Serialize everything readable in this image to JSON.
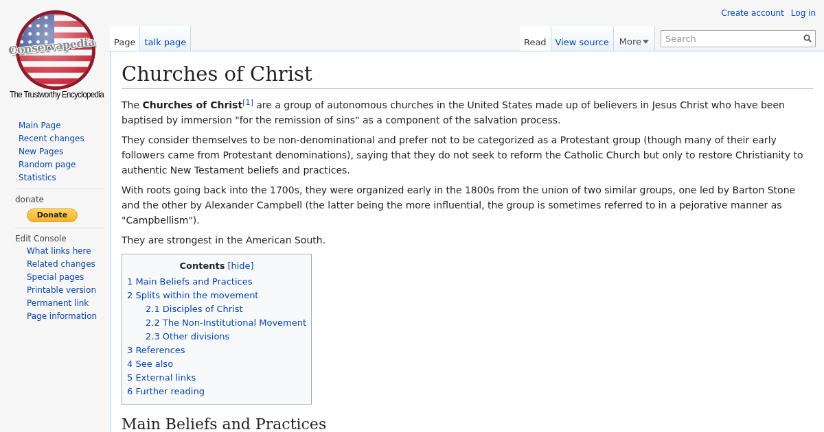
{
  "logo": {
    "name": "Conservapedia",
    "tagline": "The Trustworthy Encyclopedia"
  },
  "personal_tools": [
    "Create account",
    "Log in"
  ],
  "left_tabs": [
    {
      "label": "Page",
      "selected": true
    },
    {
      "label": "talk page",
      "selected": false
    }
  ],
  "right_tabs": [
    {
      "label": "Read",
      "selected": true
    },
    {
      "label": "View source",
      "selected": false
    }
  ],
  "more_menu": "More",
  "search": {
    "placeholder": "Search"
  },
  "sidebar": [
    {
      "kind": "links",
      "items": [
        "Main Page",
        "Recent changes",
        "New Pages",
        "Random page",
        "Statistics"
      ]
    },
    {
      "kind": "donate",
      "heading": "donate",
      "button": "Donate"
    },
    {
      "kind": "links",
      "heading": "Edit Console",
      "items": [
        "What links here",
        "Related changes",
        "Special pages",
        "Printable version",
        "Permanent link",
        "Page information"
      ]
    }
  ],
  "article": {
    "title": "Churches of Christ",
    "paragraphs": [
      "The **Churches of Christ**$^{[1]}$ are a group of autonomous churches in the United States made up of believers in Jesus Christ who have been baptised by immersion \"for the remission of sins\" as a component of the salvation process.",
      "They consider themselves to be non-denominational and prefer not to be categorized as a Protestant group (though many of their early followers came from Protestant denominations), saying that they do not seek to reform the Catholic Church but only to restore Christianity to authentic New Testament beliefs and practices.",
      "With roots going back into the 1700s, they were organized early in the 1800s from the union of two similar groups, one led by Barton Stone and the other by Alexander Campbell (the latter being the more influential, the group is sometimes referred to in a pejorative manner as \"Campbellism\").",
      "They are strongest in the American South."
    ],
    "toc": {
      "title": "Contents",
      "toggle": "[hide]",
      "items": [
        {
          "label": "1 Main Beliefs and Practices"
        },
        {
          "label": "2 Splits within the movement",
          "children": [
            {
              "label": "2.1 Disciples of Christ"
            },
            {
              "label": "2.2 The Non-Institutional Movement"
            },
            {
              "label": "2.3 Other divisions"
            }
          ]
        },
        {
          "label": "3 References"
        },
        {
          "label": "4 See also"
        },
        {
          "label": "5 External links"
        },
        {
          "label": "6 Further reading"
        }
      ]
    },
    "section_heading": "Main Beliefs and Practices"
  }
}
